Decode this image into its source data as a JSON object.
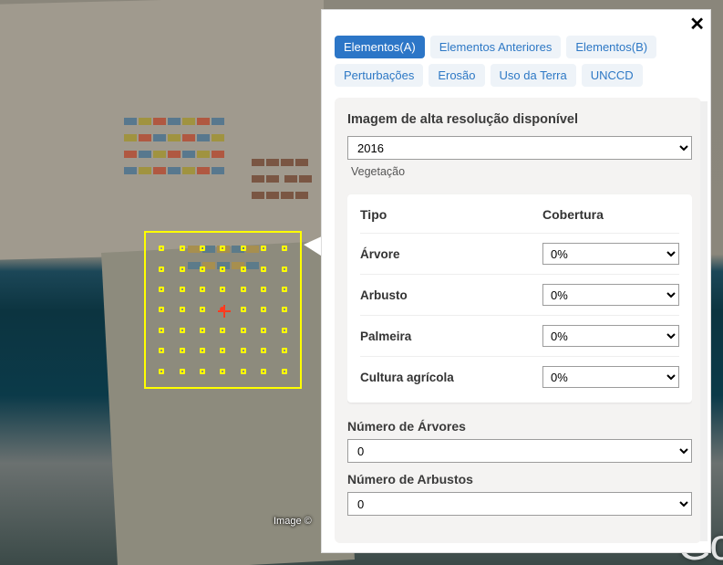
{
  "close_icon": "✕",
  "tabs": [
    {
      "key": "a",
      "label": "Elementos(A)",
      "active": true
    },
    {
      "key": "prev",
      "label": "Elementos Anteriores",
      "active": false
    },
    {
      "key": "b",
      "label": "Elementos(B)",
      "active": false
    },
    {
      "key": "pert",
      "label": "Perturbações",
      "active": false
    },
    {
      "key": "ero",
      "label": "Erosão",
      "active": false
    },
    {
      "key": "terra",
      "label": "Uso da Terra",
      "active": false
    },
    {
      "key": "unccd",
      "label": "UNCCD",
      "active": false
    }
  ],
  "section": {
    "hires_title": "Imagem de alta resolução disponível",
    "year_value": "2016",
    "veg_section_label": "Vegetação"
  },
  "veg_table": {
    "header_type": "Tipo",
    "header_cov": "Cobertura",
    "rows": [
      {
        "type": "Árvore",
        "value": "0%"
      },
      {
        "type": "Arbusto",
        "value": "0%"
      },
      {
        "type": "Palmeira",
        "value": "0%"
      },
      {
        "type": "Cultura agrícola",
        "value": "0%"
      }
    ]
  },
  "counts": {
    "trees_label": "Número de Árvores",
    "trees_value": "0",
    "shrubs_label": "Número de Arbustos",
    "shrubs_value": "0"
  },
  "attribution": "Image ©",
  "logo_fragment": "Go"
}
